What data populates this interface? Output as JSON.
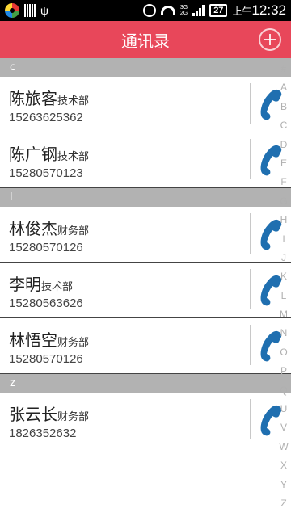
{
  "status_bar": {
    "network_type_top": "3G",
    "network_type_bottom": "2G",
    "battery_level": "27",
    "time_ampm": "上午",
    "time": "12:32"
  },
  "header": {
    "title": "通讯录",
    "add_icon": "plus-circle-icon"
  },
  "sections": [
    {
      "letter": "c",
      "contacts": [
        {
          "name": "陈旅客",
          "dept": "技术部",
          "phone": "15263625362"
        },
        {
          "name": "陈广钢",
          "dept": "技术部",
          "phone": "15280570123"
        }
      ]
    },
    {
      "letter": "l",
      "contacts": [
        {
          "name": "林俊杰",
          "dept": "财务部",
          "phone": "15280570126"
        },
        {
          "name": "李明",
          "dept": "技术部",
          "phone": "15280563626"
        },
        {
          "name": "林悟空",
          "dept": "财务部",
          "phone": "15280570126"
        }
      ]
    },
    {
      "letter": "z",
      "contacts": [
        {
          "name": "张云长",
          "dept": "财务部",
          "phone": "1826352632"
        }
      ]
    }
  ],
  "index_letters": [
    "#",
    "A",
    "B",
    "C",
    "D",
    "E",
    "F",
    "G",
    "H",
    "I",
    "J",
    "K",
    "L",
    "M",
    "N",
    "O",
    "P",
    "Q",
    "U",
    "V",
    "W",
    "X",
    "Y",
    "Z"
  ],
  "colors": {
    "header_bg": "#e8475a",
    "section_bg": "#b2b2b2",
    "call_icon": "#1f6fb0"
  }
}
